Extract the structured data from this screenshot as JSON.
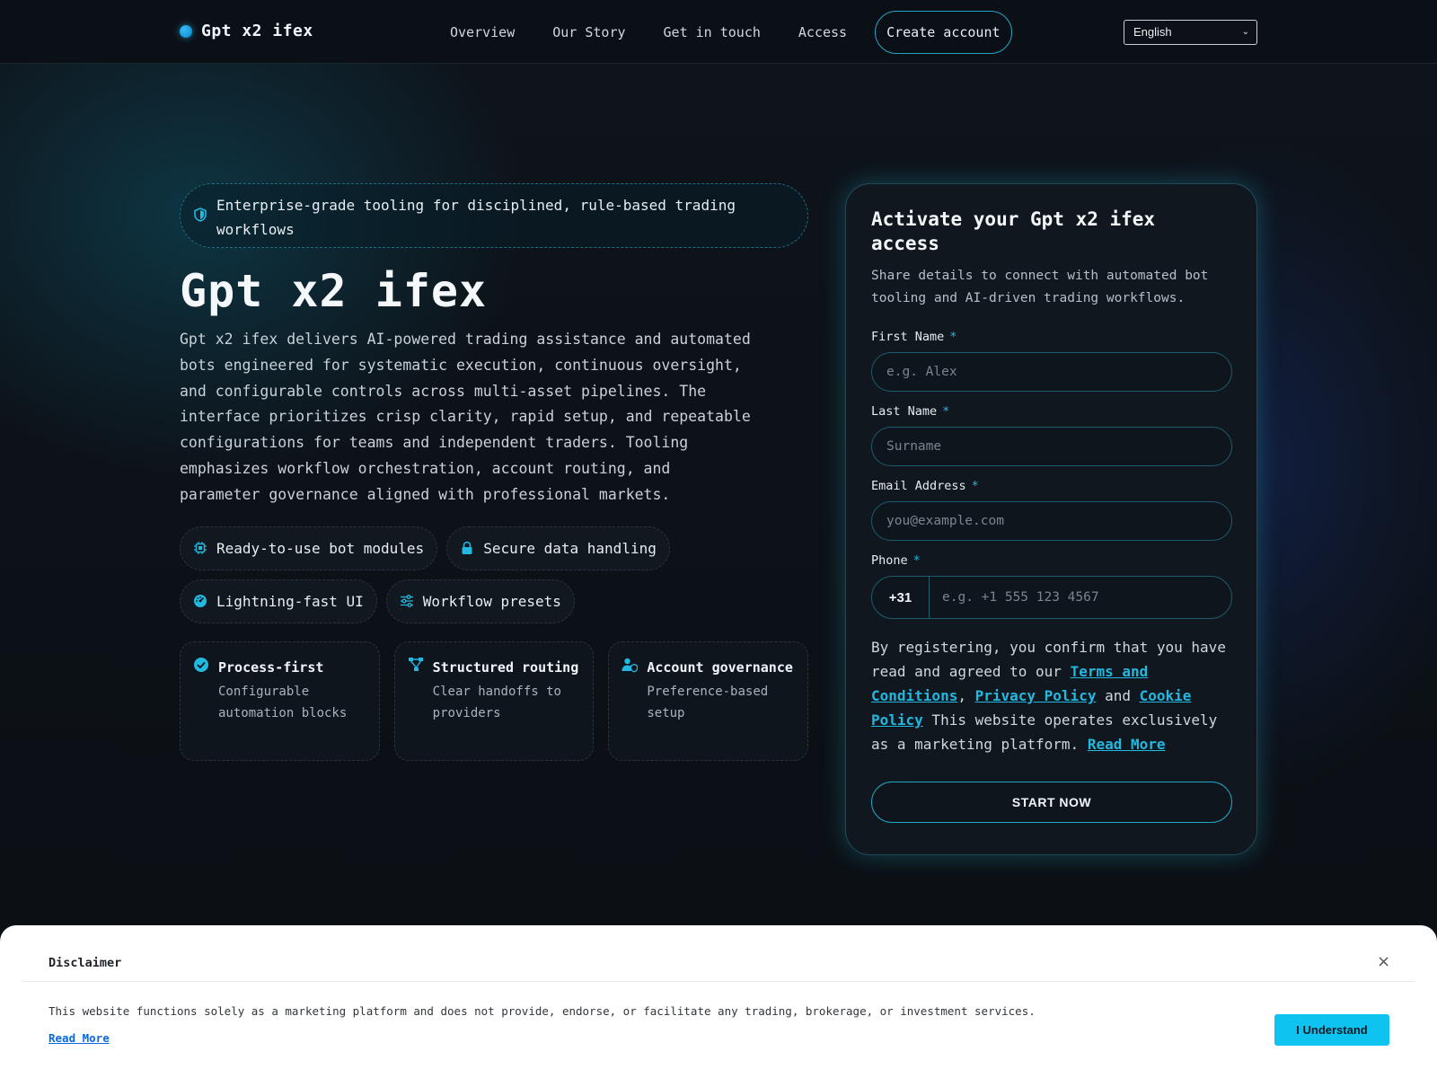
{
  "header": {
    "brand": "Gpt x2 ifex",
    "nav": [
      "Overview",
      "Our Story",
      "Get in touch",
      "Access"
    ],
    "cta": "Create account",
    "language": "English"
  },
  "hero": {
    "badge": "Enterprise-grade tooling for disciplined, rule-based trading workflows",
    "title": "Gpt x2 ifex",
    "description": "Gpt x2 ifex delivers AI-powered trading assistance and automated bots engineered for systematic execution, continuous oversight, and configurable controls across multi-asset pipelines. The interface prioritizes crisp clarity, rapid setup, and repeatable configurations for teams and independent traders. Tooling emphasizes workflow orchestration, account routing, and parameter governance aligned with professional markets.",
    "pills": [
      {
        "label": "Ready-to-use bot modules",
        "icon": "chip-icon"
      },
      {
        "label": "Secure data handling",
        "icon": "lock-icon"
      },
      {
        "label": "Lightning-fast UI",
        "icon": "gauge-icon"
      },
      {
        "label": "Workflow presets",
        "icon": "sliders-icon"
      }
    ],
    "features": [
      {
        "title": "Process-first",
        "desc": "Configurable automation blocks",
        "icon": "check-circle-icon"
      },
      {
        "title": "Structured routing",
        "desc": "Clear handoffs to providers",
        "icon": "routing-icon"
      },
      {
        "title": "Account governance",
        "desc": "Preference-based setup",
        "icon": "user-shield-icon"
      }
    ]
  },
  "form": {
    "title": "Activate your Gpt x2 ifex access",
    "subtitle": "Share details to connect with automated bot tooling and AI-driven trading workflows.",
    "first_name_label": "First Name",
    "first_name_placeholder": "e.g. Alex",
    "last_name_label": "Last Name",
    "last_name_placeholder": "Surname",
    "email_label": "Email Address",
    "email_placeholder": "you@example.com",
    "phone_label": "Phone",
    "phone_code": "+31",
    "phone_placeholder": "e.g. +1 555 123 4567",
    "required_mark": "*",
    "consent_prefix": "By registering, you confirm that you have read and agreed to our ",
    "terms_link": "Terms and Conditions",
    "sep1": ", ",
    "privacy_link": "Privacy Policy",
    "sep2": " and ",
    "cookie_link": "Cookie Policy",
    "consent_suffix": " This website operates exclusively as a marketing platform. ",
    "read_more": "Read More",
    "submit": "START NOW"
  },
  "disclaimer": {
    "title": "Disclaimer",
    "close": "×",
    "text": "This website functions solely as a marketing platform and does not provide, endorse, or facilitate any trading, brokerage, or investment services.",
    "link": "Read More",
    "button": "I Understand"
  },
  "colors": {
    "accent": "#22b8e0",
    "background": "#0d1117",
    "card_border": "#214a58",
    "disclaimer_button": "#0ec3f0"
  }
}
